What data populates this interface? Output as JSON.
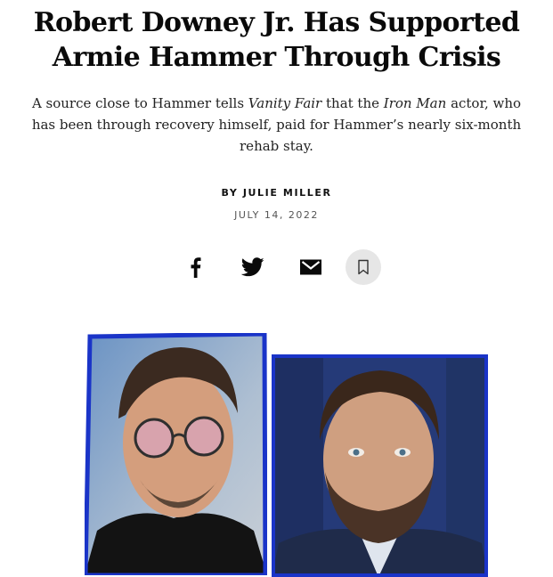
{
  "article": {
    "headline": "Robert Downey Jr. Has Supported Armie Hammer Through Crisis",
    "dek": {
      "part1": "A source close to Hammer tells ",
      "publication": "Vanity Fair",
      "part2": " that the ",
      "film": "Iron Man",
      "part3": " actor, who has been through recovery himself, paid for Hammer’s nearly six-month rehab stay."
    },
    "byline_prefix": "BY ",
    "author": "JULIE MILLER",
    "date": "JULY 14, 2022"
  },
  "share": {
    "icons": [
      "facebook-icon",
      "twitter-icon",
      "email-icon",
      "bookmark-icon"
    ]
  },
  "colors": {
    "photo_border": "#1a34c8",
    "save_button_bg": "#e6e6e6",
    "text": "#111111"
  }
}
